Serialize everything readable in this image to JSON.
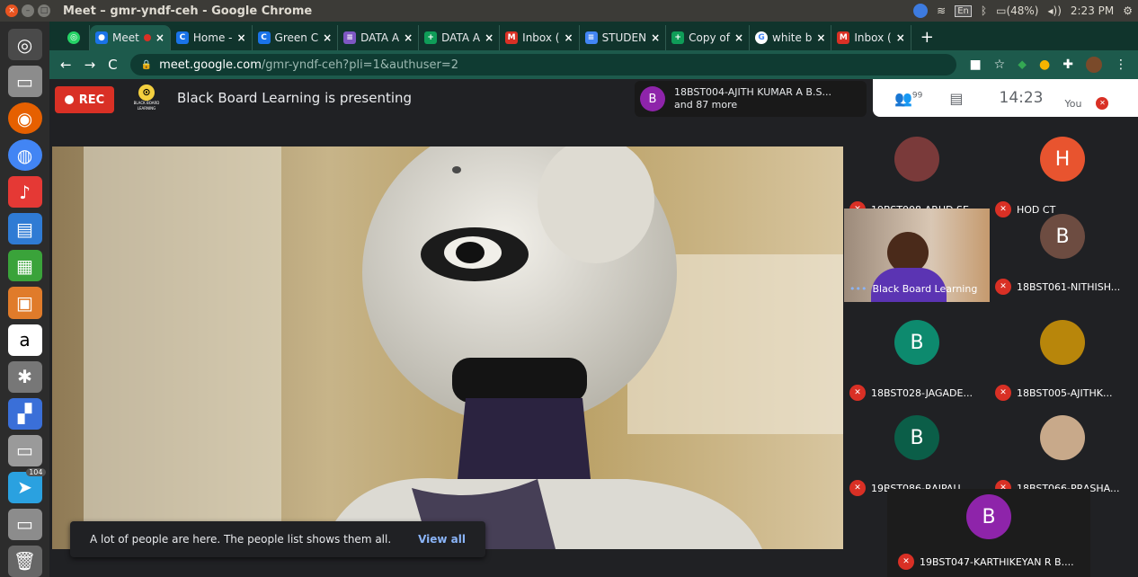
{
  "os": {
    "window_title": "Meet – gmr-yndf-ceh - Google Chrome",
    "tray": {
      "chrome_badge": "104",
      "lang": "En",
      "battery": "(48%)",
      "time": "2:23 PM"
    },
    "launcher_badge": "104"
  },
  "browser": {
    "tabs": [
      {
        "label": "Meet",
        "color": "#1a73e8",
        "glyph": "●",
        "active": true
      },
      {
        "label": "Home -",
        "color": "#1a73e8",
        "glyph": "C"
      },
      {
        "label": "Green C",
        "color": "#1a73e8",
        "glyph": "C"
      },
      {
        "label": "DATA A",
        "color": "#7e57c2",
        "glyph": "≡"
      },
      {
        "label": "DATA A",
        "color": "#0f9d58",
        "glyph": "+"
      },
      {
        "label": "Inbox (",
        "color": "#d93025",
        "glyph": "M"
      },
      {
        "label": "STUDEN",
        "color": "#4285f4",
        "glyph": "≡"
      },
      {
        "label": "Copy of",
        "color": "#0f9d58",
        "glyph": "+"
      },
      {
        "label": "white b",
        "color": "#ffffff",
        "glyph": "G"
      },
      {
        "label": "Inbox (",
        "color": "#d93025",
        "glyph": "M"
      }
    ],
    "url_host": "meet.google.com",
    "url_path": "/gmr-yndf-ceh?pli=1&authuser=2"
  },
  "meet": {
    "rec_label": "REC",
    "logo_text": "BLACK BOARD LEARNING",
    "presenting_text": "Black Board Learning is presenting",
    "joiner": {
      "initial": "B",
      "line1": "18BST004-AJITH KUMAR A B.S...",
      "line2": "and 87 more"
    },
    "panel": {
      "people_count": "99",
      "time": "14:23",
      "you_label": "You"
    },
    "toast": {
      "message": "A lot of people are here. The people list shows them all.",
      "action": "View all"
    },
    "participants": [
      {
        "name": "19BST008-ARUD SE...",
        "initial": "",
        "color": "#7a3a3a"
      },
      {
        "name": "HOD CT",
        "initial": "H",
        "color": "#e8542f"
      },
      {
        "name": "Black Board Learning",
        "initial": "",
        "color": "#6b3fa0",
        "video": true
      },
      {
        "name": "18BST061-NITHISH...",
        "initial": "B",
        "color": "#6d4c41"
      },
      {
        "name": "18BST028-JAGADE...",
        "initial": "B",
        "color": "#0d8a6e"
      },
      {
        "name": "18BST005-AJITHK...",
        "initial": "",
        "color": "#b8860b"
      },
      {
        "name": "19BST086-RAJPAU...",
        "initial": "B",
        "color": "#0b5e48"
      },
      {
        "name": "18BST066-PRASHA...",
        "initial": "",
        "color": "#c8a98a"
      },
      {
        "name": "19BST047-KARTHIKEYAN R B....",
        "initial": "B",
        "color": "#8e24aa"
      }
    ]
  }
}
